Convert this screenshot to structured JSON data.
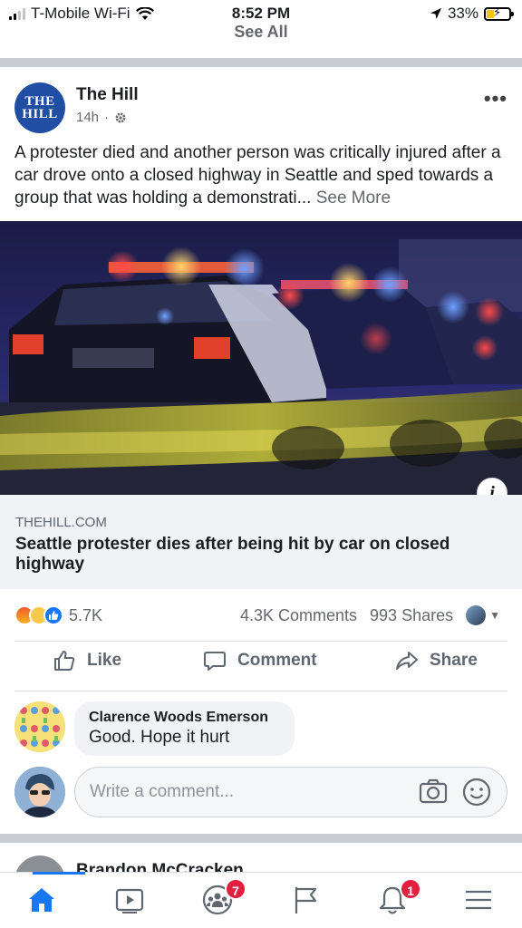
{
  "status_bar": {
    "carrier": "T-Mobile Wi-Fi",
    "time": "8:52 PM",
    "battery_percent": "33%",
    "battery_level": 0.33
  },
  "header": {
    "see_all": "See All"
  },
  "post": {
    "page_name": "The Hill",
    "avatar_text": "THE HILL",
    "time_ago": "14h",
    "text": "A protester died and another person was critically injured after a car drove onto a closed highway in Seattle and sped towards a group that was holding a demonstrati...",
    "see_more": "See More",
    "link": {
      "domain": "THEHILL.COM",
      "title": "Seattle protester dies after being hit by car on closed highway"
    },
    "reactions": {
      "count": "5.7K",
      "comments": "4.3K Comments",
      "shares": "993 Shares"
    },
    "actions": {
      "like": "Like",
      "comment": "Comment",
      "share": "Share"
    },
    "top_comment": {
      "author": "Clarence Woods Emerson",
      "text": "Good. Hope it hurt"
    },
    "write_comment_placeholder": "Write a comment..."
  },
  "next_post": {
    "author": "Brandon McCracken"
  },
  "tab_bar": {
    "groups_badge": "7",
    "notifications_badge": "1",
    "accent_color": "#1877f2",
    "badge_color": "#e41e3f"
  },
  "colors": {
    "facebook_blue": "#1877f2",
    "hill_blue": "#1f4ea3",
    "meta_gray": "#65676b"
  }
}
